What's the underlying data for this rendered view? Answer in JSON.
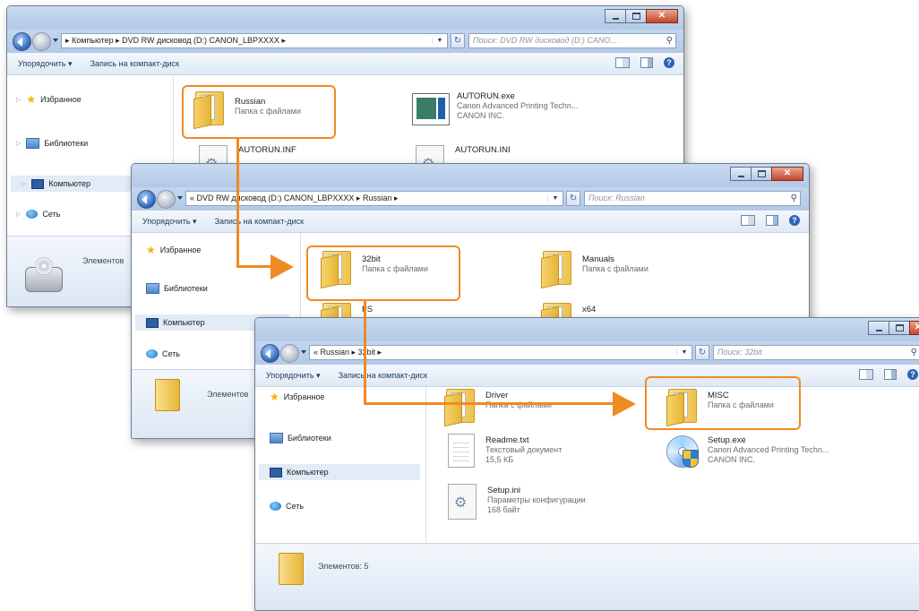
{
  "ui": {
    "toolbar": {
      "organize": "Упорядочить ▾",
      "burn": "Запись на компакт-диск"
    },
    "nav": {
      "favorites": "Избранное",
      "libraries": "Библиотеки",
      "computer": "Компьютер",
      "network": "Сеть"
    }
  },
  "windows": [
    {
      "address": "▸ Компьютер ▸ DVD RW дисковод (D:) CANON_LBPXXXX ▸",
      "search_placeholder": "Поиск: DVD RW дисковод (D:) CANO...",
      "items": [
        {
          "name": "Russian",
          "sub1": "Папка с файлами",
          "sub2": ""
        },
        {
          "name": "AUTORUN.exe",
          "sub1": "Canon Advanced Printing Techn...",
          "sub2": "CANON INC."
        },
        {
          "name": "AUTORUN.INF",
          "sub1": "",
          "sub2": ""
        },
        {
          "name": "AUTORUN.INI",
          "sub1": "",
          "sub2": ""
        }
      ],
      "details_count": "Элементов"
    },
    {
      "address": "« DVD RW дисковод (D:) CANON_LBPXXXX ▸ Russian ▸",
      "search_placeholder": "Поиск: Russian",
      "items": [
        {
          "name": "32bit",
          "sub1": "Папка с файлами"
        },
        {
          "name": "Manuals",
          "sub1": "Папка с файлами"
        },
        {
          "name": "FS",
          "sub1": ""
        },
        {
          "name": "x64",
          "sub1": ""
        }
      ],
      "details_count": "Элементов"
    },
    {
      "address": "« Russian ▸ 32bit ▸",
      "search_placeholder": "Поиск: 32bit",
      "items": [
        {
          "name": "Driver",
          "sub1": "Папка с файлами",
          "sub2": "",
          "sub3": ""
        },
        {
          "name": "MISC",
          "sub1": "Папка с файлами",
          "sub2": "",
          "sub3": ""
        },
        {
          "name": "Readme.txt",
          "sub1": "Текстовый документ",
          "sub2": "15,5 КБ",
          "sub3": ""
        },
        {
          "name": "Setup.exe",
          "sub1": "Canon Advanced Printing Techn...",
          "sub2": "CANON INC.",
          "sub3": ""
        },
        {
          "name": "Setup.ini",
          "sub1": "Параметры конфигурации",
          "sub2": "168 байт",
          "sub3": ""
        }
      ],
      "details_count": "Элементов: 5"
    }
  ],
  "colors": {
    "highlight": "#f08a24",
    "accent": "#2d63b6"
  }
}
